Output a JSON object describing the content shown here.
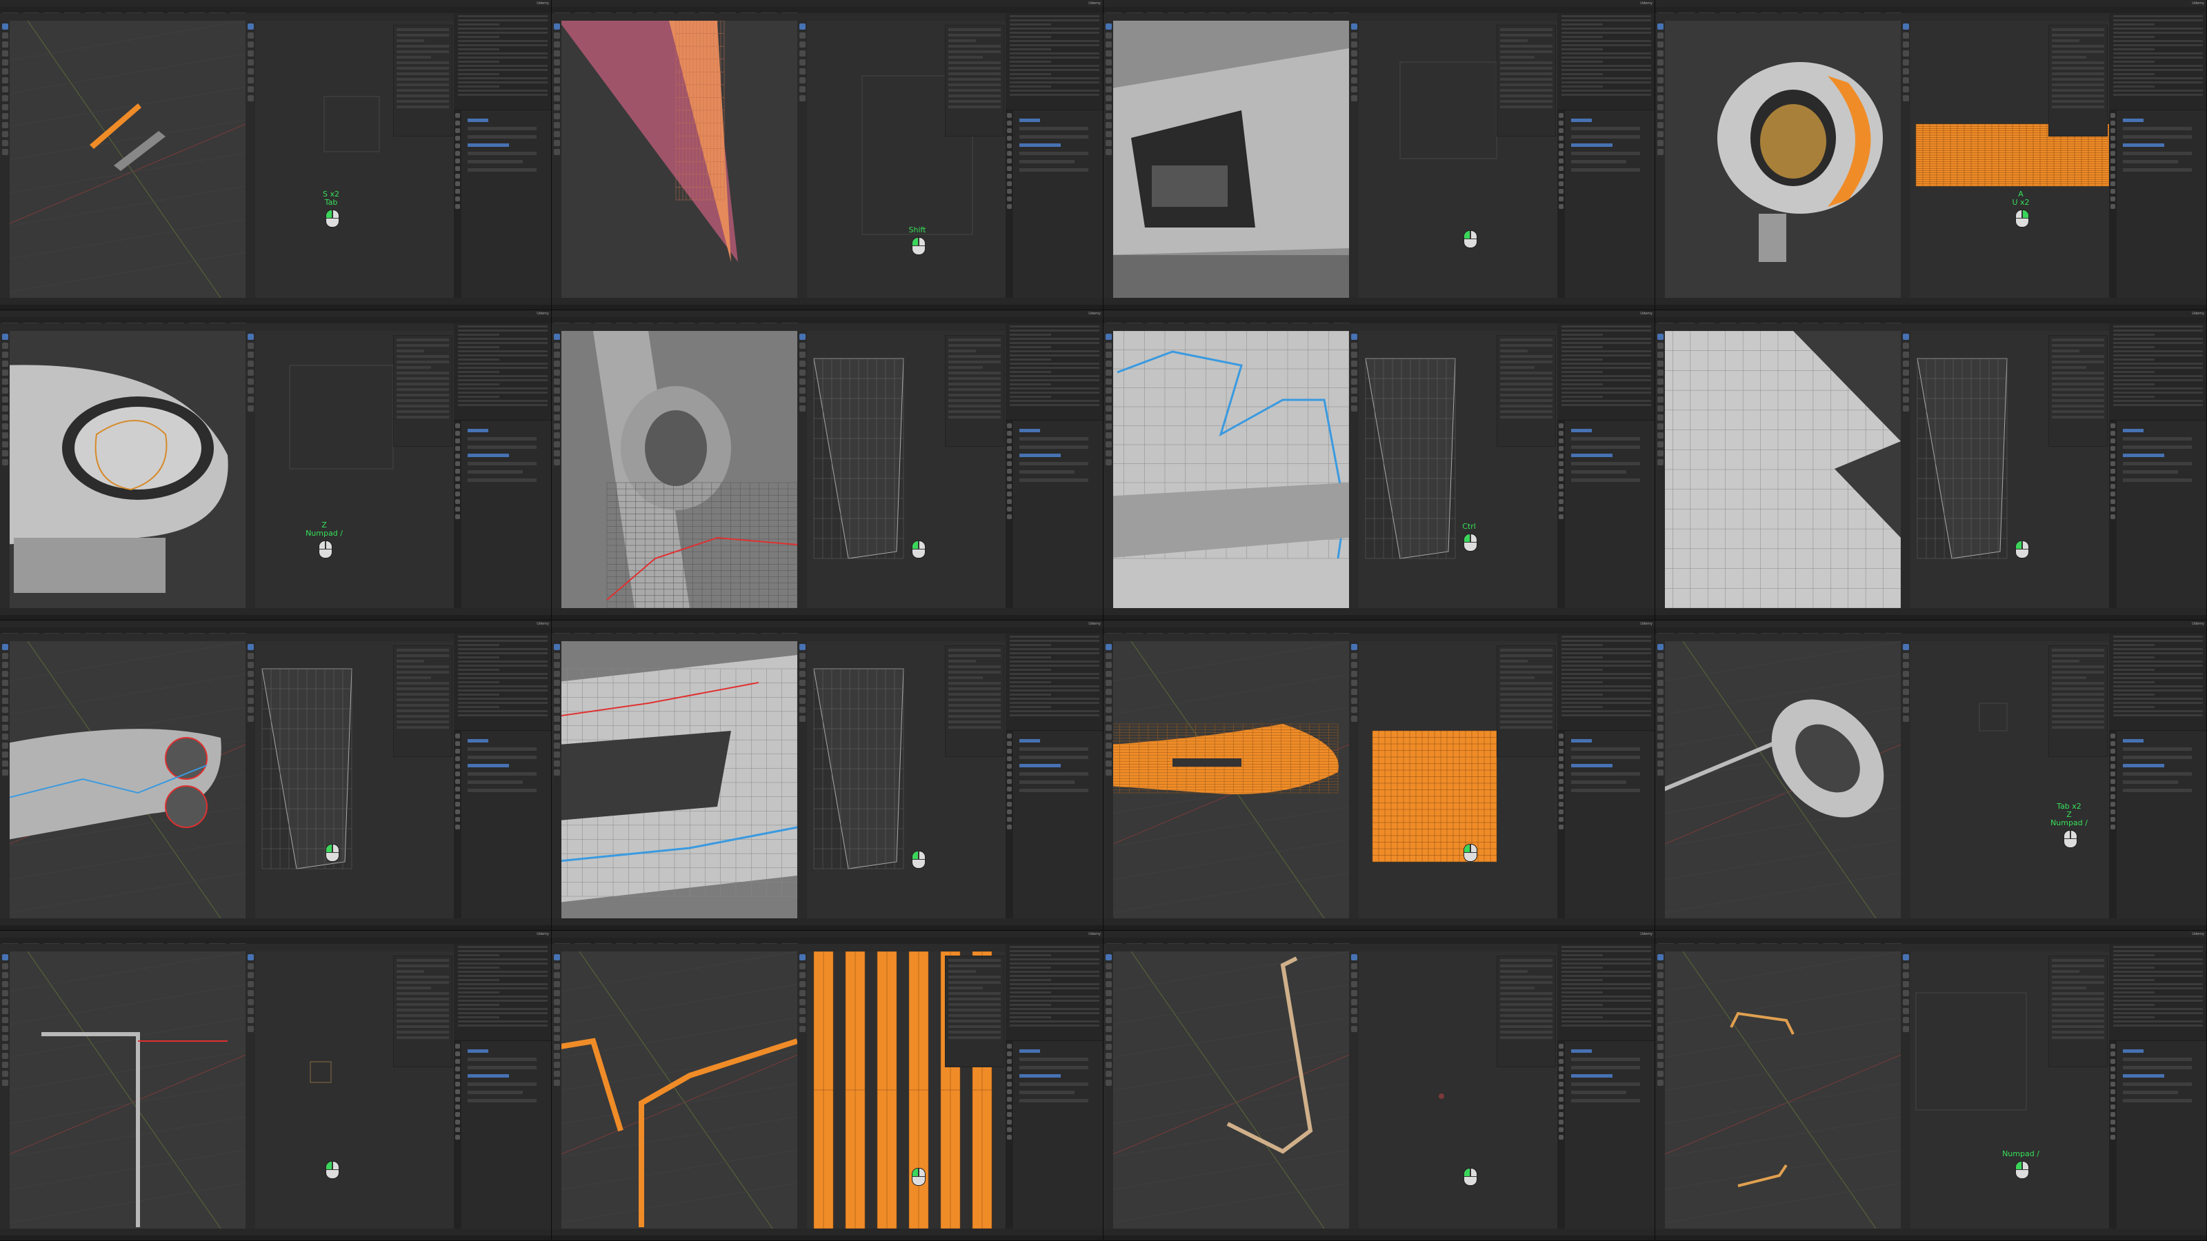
{
  "app": {
    "menu": [
      "File",
      "Edit",
      "Render",
      "Window",
      "Help"
    ],
    "watermark": "Udemy"
  },
  "colors": {
    "selection": "#f08c28",
    "seam": "#e03030",
    "edge_select": "#3a9ae0",
    "keycast": "#37e05a",
    "viewport": "#393939",
    "uv_bg": "#2f2f2f",
    "mesh_gray": "#b8b8b8"
  },
  "tiles": [
    {
      "id": 1,
      "keys": [
        "S x2",
        "Tab"
      ],
      "mouse": "left",
      "icon": "uv-tile-icon"
    },
    {
      "id": 2,
      "keys": [
        "Shift"
      ],
      "mouse": "left",
      "icon": "uv-tile-icon"
    },
    {
      "id": 3,
      "keys": [],
      "mouse": "left",
      "icon": "uv-tile-icon"
    },
    {
      "id": 4,
      "keys": [
        "A",
        "U x2"
      ],
      "mouse": "right",
      "icon": "uv-tile-icon"
    },
    {
      "id": 5,
      "keys": [
        "Z",
        "Numpad /"
      ],
      "mouse": "none",
      "icon": "uv-tile-icon"
    },
    {
      "id": 6,
      "keys": [],
      "mouse": "left",
      "icon": "uv-tile-icon"
    },
    {
      "id": 7,
      "keys": [
        "Ctrl"
      ],
      "mouse": "left",
      "icon": "uv-tile-icon"
    },
    {
      "id": 8,
      "keys": [],
      "mouse": "left",
      "icon": "uv-tile-icon"
    },
    {
      "id": 9,
      "keys": [],
      "mouse": "left",
      "icon": "uv-tile-icon"
    },
    {
      "id": 10,
      "keys": [],
      "mouse": "left",
      "icon": "uv-tile-icon"
    },
    {
      "id": 11,
      "keys": [],
      "mouse": "left",
      "icon": "uv-tile-icon"
    },
    {
      "id": 12,
      "keys": [
        "Tab x2",
        "Z",
        "Numpad /"
      ],
      "mouse": "none",
      "icon": "uv-tile-icon"
    },
    {
      "id": 13,
      "keys": [],
      "mouse": "left",
      "icon": "uv-tile-icon"
    },
    {
      "id": 14,
      "keys": [],
      "mouse": "left",
      "icon": "uv-tile-icon"
    },
    {
      "id": 15,
      "keys": [],
      "mouse": "left",
      "icon": "uv-tile-icon"
    },
    {
      "id": 16,
      "keys": [
        "Numpad /"
      ],
      "mouse": "left",
      "icon": "uv-tile-icon"
    }
  ]
}
